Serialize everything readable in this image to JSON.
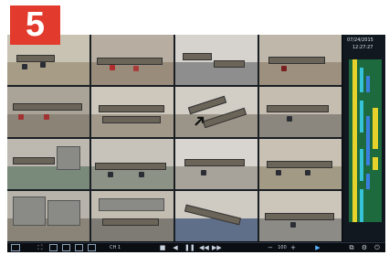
{
  "badge": {
    "number": "5"
  },
  "sidebar": {
    "date": "07/24/2015",
    "time": "12:27:27"
  },
  "toolbar": {
    "cam_label": "CH 1",
    "zoom_label": "100"
  },
  "colors": {
    "accent": "#e23a2c",
    "timeline_green": "#1c6a3e",
    "timeline_yellow": "#e6d22a",
    "timeline_blue": "#3a7fe0",
    "timeline_cyan": "#36c2d8"
  }
}
